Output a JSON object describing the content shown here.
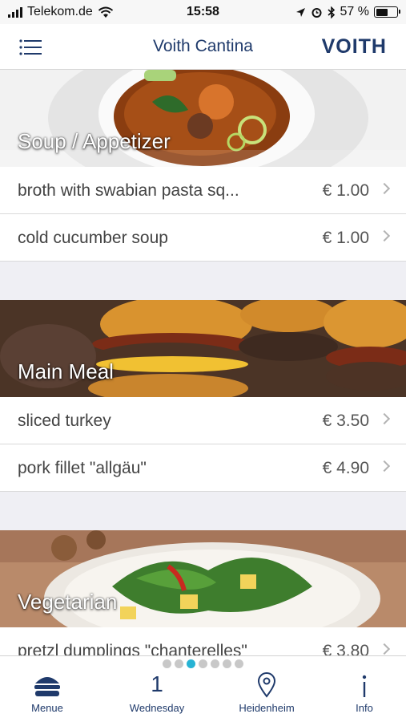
{
  "status_bar": {
    "carrier": "Telekom.de",
    "time": "15:58",
    "battery_percent_text": "57 %",
    "battery_level": 0.57
  },
  "header": {
    "title": "Voith Cantina",
    "logo_text": "VOITH",
    "brand_color": "#1f3a6b"
  },
  "sections": [
    {
      "title": "Soup / Appetizer",
      "items": [
        {
          "name": "broth with swabian pasta sq...",
          "price": "€ 1.00"
        },
        {
          "name": "cold cucumber soup",
          "price": "€ 1.00"
        }
      ]
    },
    {
      "title": "Main Meal",
      "items": [
        {
          "name": "sliced turkey",
          "price": "€ 3.50"
        },
        {
          "name": "pork fillet \"allgäu\"",
          "price": "€ 4.90"
        }
      ]
    },
    {
      "title": "Vegetarian",
      "items": [
        {
          "name": "pretzl dumplings \"chanterelles\"",
          "price": "€ 3.80"
        }
      ]
    }
  ],
  "pager": {
    "count": 7,
    "active_index": 2,
    "active_color": "#27b3d4"
  },
  "tabs": [
    {
      "label": "Menue",
      "icon": "burger-icon"
    },
    {
      "label": "Wednesday",
      "icon_text": "1"
    },
    {
      "label": "Heidenheim",
      "icon": "location-pin-icon"
    },
    {
      "label": "Info",
      "icon": "info-icon"
    }
  ]
}
